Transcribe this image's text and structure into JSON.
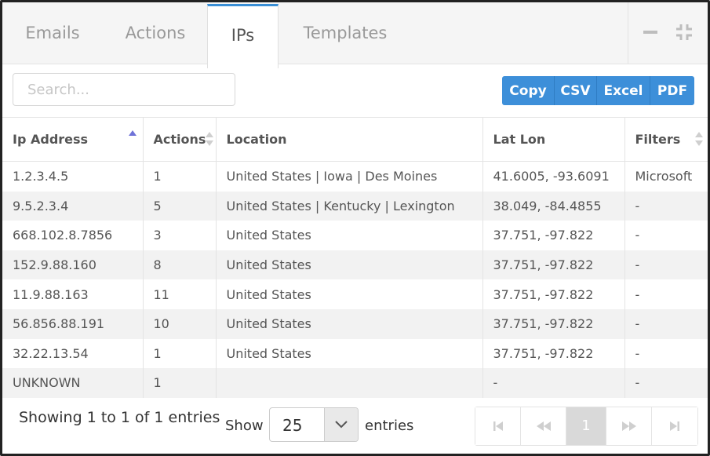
{
  "tabs": [
    {
      "label": "Emails",
      "active": false
    },
    {
      "label": "Actions",
      "active": false
    },
    {
      "label": "IPs",
      "active": true
    },
    {
      "label": "Templates",
      "active": false
    }
  ],
  "tab_tools": {
    "minimize_icon": "minus-icon",
    "collapse_icon": "compress-icon"
  },
  "search": {
    "placeholder": "Search..."
  },
  "export_buttons": [
    "Copy",
    "CSV",
    "Excel",
    "PDF"
  ],
  "table": {
    "columns": [
      "Ip Address",
      "Actions",
      "Location",
      "Lat Lon",
      "Filters"
    ],
    "sorted_column": "Ip Address",
    "sort_direction": "ascending",
    "rows": [
      [
        "1.2.3.4.5",
        "1",
        "United States | Iowa | Des Moines",
        "41.6005, -93.6091",
        "Microsoft"
      ],
      [
        "9.5.2.3.4",
        "5",
        "United States | Kentucky | Lexington",
        "38.049, -84.4855",
        "-"
      ],
      [
        "668.102.8.7856",
        "3",
        "United States",
        "37.751, -97.822",
        "-"
      ],
      [
        "152.9.88.160",
        "8",
        "United States",
        "37.751, -97.822",
        "-"
      ],
      [
        "11.9.88.163",
        "11",
        "United States",
        "37.751, -97.822",
        "-"
      ],
      [
        "56.856.88.191",
        "10",
        "United States",
        "37.751, -97.822",
        "-"
      ],
      [
        "32.22.13.54",
        "1",
        "United States",
        "37.751, -97.822",
        "-"
      ],
      [
        "UNKNOWN",
        "1",
        "",
        "-",
        "-"
      ]
    ]
  },
  "footer": {
    "info": "Showing 1 to 1 of 1 entries",
    "show_label": "Show",
    "page_length": "25",
    "entries_label": "entries",
    "current_page": "1"
  },
  "colors": {
    "accent": "#3d8fd9",
    "active_tab_border": "#3a8fd6",
    "sort_active": "#6f73d8"
  }
}
